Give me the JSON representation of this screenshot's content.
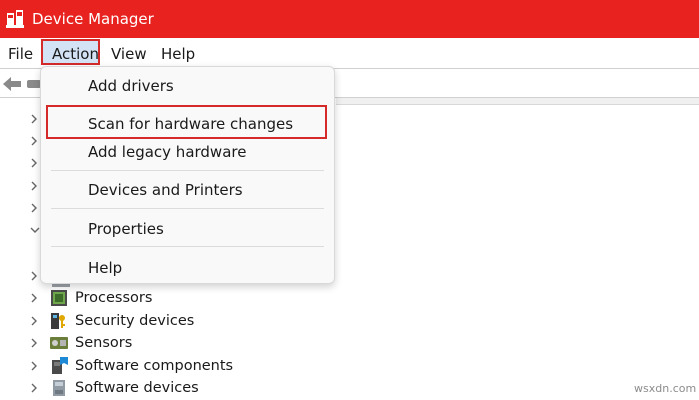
{
  "window": {
    "title": "Device Manager"
  },
  "menubar": {
    "file": "File",
    "action": "Action",
    "view": "View",
    "help": "Help"
  },
  "action_menu": {
    "items": [
      "Add drivers",
      "Scan for hardware changes",
      "Add legacy hardware",
      "Devices and Printers",
      "Properties",
      "Help"
    ],
    "highlighted": "Scan for hardware changes"
  },
  "tree": {
    "rows": [
      {
        "label": "Processors"
      },
      {
        "label": "Security devices"
      },
      {
        "label": "Sensors"
      },
      {
        "label": "Software components"
      },
      {
        "label": "Software devices"
      }
    ]
  },
  "colors": {
    "titlebar": "#e8231f",
    "highlight_border": "#d42a2a",
    "menu_selected": "#d3e3f5"
  },
  "watermark": "wsxdn.com"
}
